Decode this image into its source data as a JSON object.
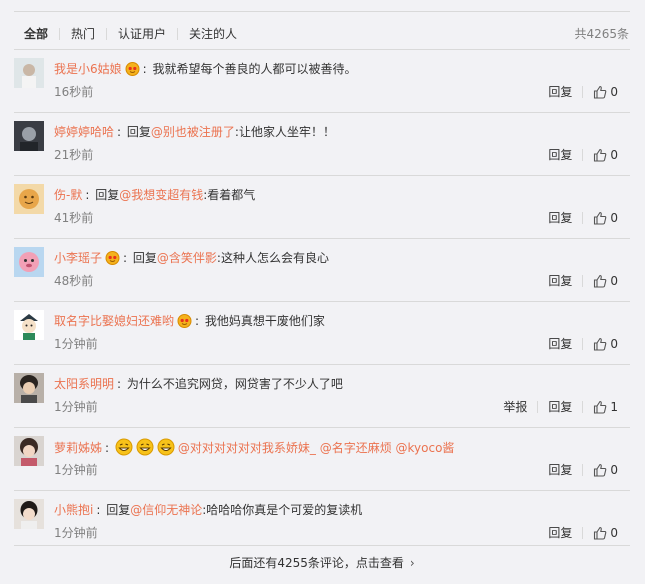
{
  "tabs": [
    {
      "label": "全部",
      "active": true
    },
    {
      "label": "热门",
      "active": false
    },
    {
      "label": "认证用户",
      "active": false
    },
    {
      "label": "关注的人",
      "active": false
    }
  ],
  "total": "共4265条",
  "comments": [
    {
      "user": "我是小6姑娘",
      "badge": "crown-face-icon",
      "text": "我就希望每个善良的人都可以被善待。",
      "time": "16秒前",
      "likes": "0"
    },
    {
      "user": "婷婷婷哈哈",
      "reply_prefix": "回复",
      "mention": "@别也被注册了",
      "text": ":让他家人坐牢！！",
      "time": "21秒前",
      "likes": "0"
    },
    {
      "user": "伤-默",
      "reply_prefix": "回复",
      "mention": "@我想变超有钱",
      "text": ":看着都气",
      "time": "41秒前",
      "likes": "0"
    },
    {
      "user": "小李瑶子",
      "badge": "crown-face-icon",
      "reply_prefix": "回复",
      "mention": "@含笑伴影",
      "text": ":这种人怎么会有良心",
      "time": "48秒前",
      "likes": "0"
    },
    {
      "user": "取名字比娶媳妇还难哟",
      "badge": "crown-face-icon",
      "text": "我他妈真想干废他们家",
      "time": "1分钟前",
      "likes": "0"
    },
    {
      "user": "太阳系明明",
      "text": "为什么不追究网贷，网贷害了不少人了吧",
      "time": "1分钟前",
      "likes": "1",
      "report": "举报"
    },
    {
      "user": "萝莉姊姊",
      "emojis": [
        "grin-icon",
        "grin-icon",
        "grin-icon"
      ],
      "mention": "@对对对对对对我系娇妹_ @名字还麻烦 @kyoco酱",
      "text": "",
      "time": "1分钟前",
      "likes": "0"
    },
    {
      "user": "小熊抱i",
      "reply_prefix": "回复",
      "mention": "@信仰无神论",
      "text": ":哈哈哈你真是个可爱的复读机",
      "time": "1分钟前",
      "likes": "0"
    }
  ],
  "reply_label": "回复",
  "more_text": "后面还有4255条评论，点击查看",
  "colors": {
    "accent": "#eb7350",
    "text": "#333333",
    "muted": "#808080",
    "bg": "#f2f2f5"
  }
}
